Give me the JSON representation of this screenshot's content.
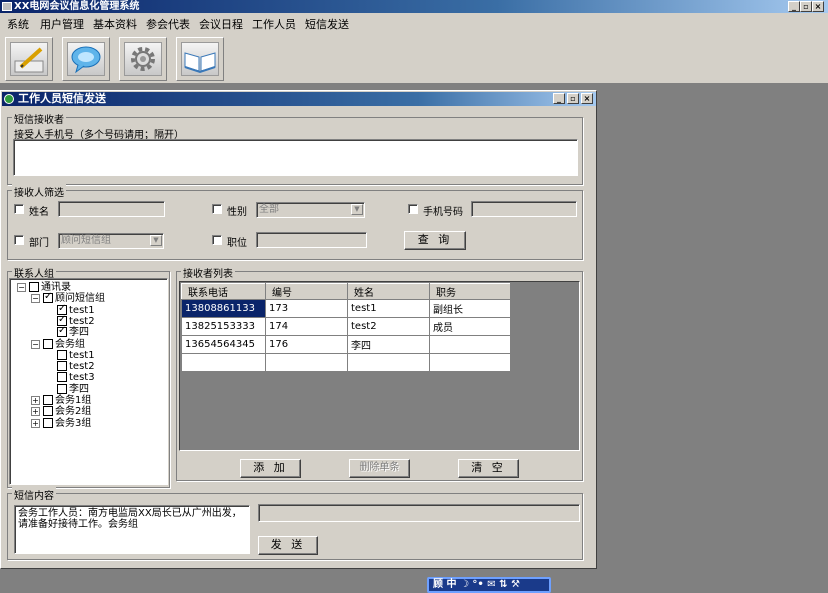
{
  "app": {
    "title": "XX电网会议信息化管理系统"
  },
  "window_controls": {
    "minimize": "_",
    "restore": "▫",
    "close": "×"
  },
  "menu": [
    "系统",
    "用户管理",
    "基本资料",
    "参会代表",
    "会议日程",
    "工作人员",
    "短信发送"
  ],
  "toolbar": [
    "pencil-icon",
    "speech-bubble-icon",
    "gear-icon",
    "book-icon"
  ],
  "dialog": {
    "title": "工作人员短信发送",
    "receiver_group": {
      "legend": "短信接收者",
      "phone_label": "接受人手机号（多个号码请用；隔开）",
      "phone_value": ""
    },
    "filter_group": {
      "legend": "接收人筛选",
      "name_label": "姓名",
      "gender_label": "性别",
      "gender_value": "全部",
      "mobile_label": "手机号码",
      "dept_label": "部门",
      "dept_value": "顾问短信组",
      "position_label": "职位",
      "query_button": "查  询"
    },
    "contacts_group": {
      "legend": "联系人组",
      "tree": [
        {
          "label": "通讯录",
          "checked": false,
          "level": 0,
          "expander": "−"
        },
        {
          "label": "顾问短信组",
          "checked": true,
          "level": 1,
          "expander": "−"
        },
        {
          "label": "test1",
          "checked": true,
          "level": 2
        },
        {
          "label": "test2",
          "checked": true,
          "level": 2
        },
        {
          "label": "李四",
          "checked": true,
          "level": 2
        },
        {
          "label": "会务组",
          "checked": false,
          "level": 1,
          "expander": "−"
        },
        {
          "label": "test1",
          "checked": false,
          "level": 2
        },
        {
          "label": "test2",
          "checked": false,
          "level": 2
        },
        {
          "label": "test3",
          "checked": false,
          "level": 2
        },
        {
          "label": "李四",
          "checked": false,
          "level": 2
        },
        {
          "label": "会务1组",
          "checked": false,
          "level": 1,
          "expander": "+"
        },
        {
          "label": "会务2组",
          "checked": false,
          "level": 1,
          "expander": "+"
        },
        {
          "label": "会务3组",
          "checked": false,
          "level": 1,
          "expander": "+"
        }
      ]
    },
    "recipients_group": {
      "legend": "接收者列表",
      "columns": [
        "联系电话",
        "编号",
        "姓名",
        "职务"
      ],
      "rows": [
        [
          "13808861133",
          "173",
          "test1",
          "副组长"
        ],
        [
          "13825153333",
          "174",
          "test2",
          "成员"
        ],
        [
          "13654564345",
          "176",
          "李四",
          ""
        ],
        [
          "",
          "",
          "",
          ""
        ]
      ],
      "add_button": "添  加",
      "delete_button": "删除单条",
      "clear_button": "清  空"
    },
    "content_group": {
      "legend": "短信内容",
      "message": "会务工作人员：南方电监局XX局长已从广州出发，请准备好接待工作。会务组",
      "send_button": "发  送"
    }
  },
  "taskbar": {
    "ime_text": "顾 中 ☽ °• ✉ ⇅ ⚒"
  }
}
